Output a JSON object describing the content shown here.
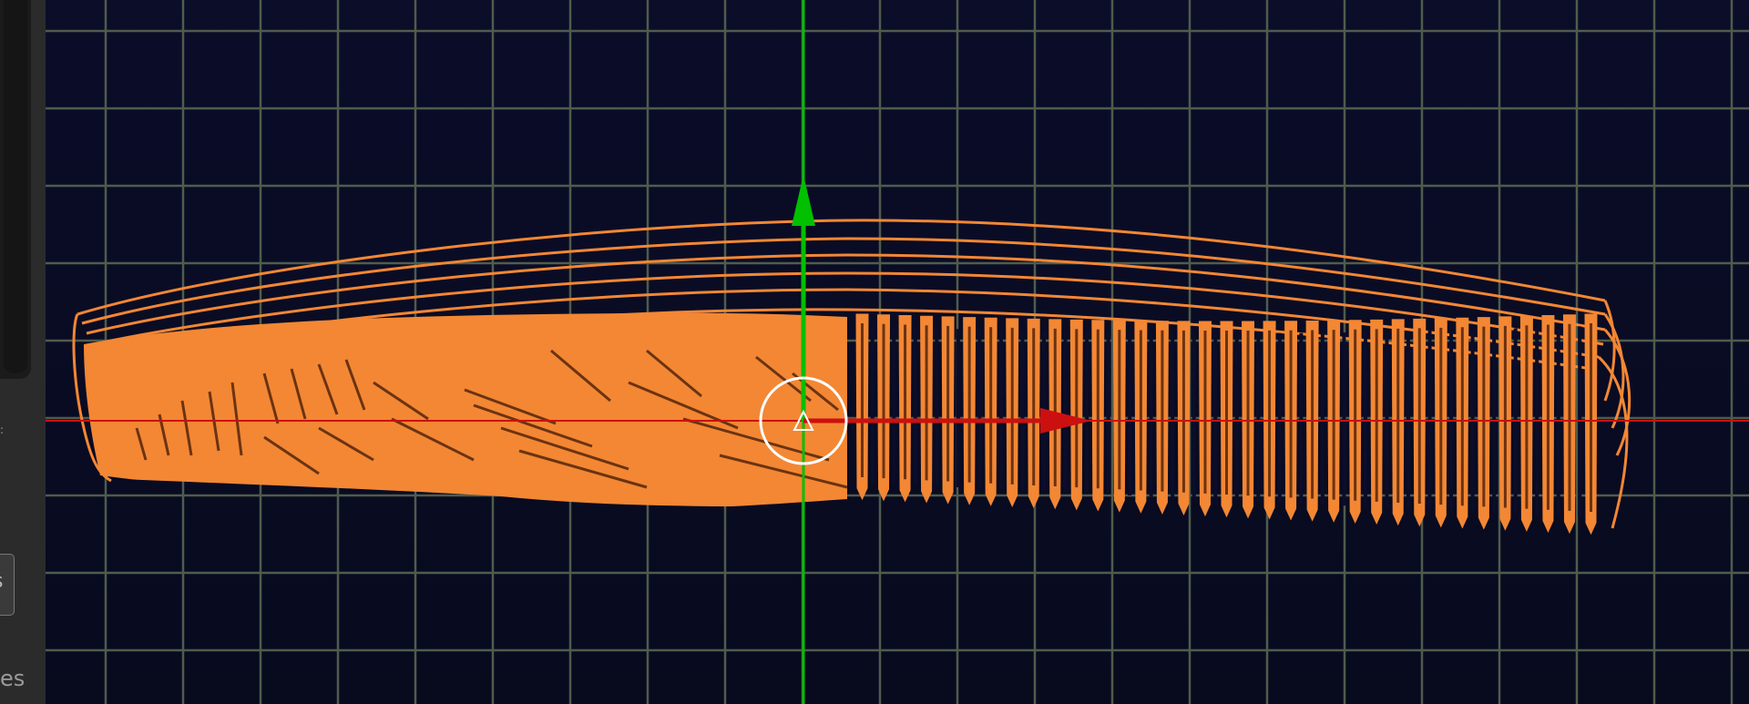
{
  "colors": {
    "background": "#0b0d29",
    "grid": "#4f5c4c",
    "object": "#f38734",
    "object_dark": "#6b3311",
    "y_axis": "#00c000",
    "x_axis": "#cc1010",
    "gizmo_ring": "#ffffff",
    "panel": "#2b2b2b"
  },
  "viewport": {
    "object_name": "comb",
    "display_mode": "wireframe",
    "selected": true
  },
  "left_panel": {
    "marker_text": ":",
    "button_text": "s",
    "caption_text": "es"
  },
  "icons": {
    "origin_marker": "origin-icon",
    "transform_gizmo": "transform-gizmo-icon"
  }
}
